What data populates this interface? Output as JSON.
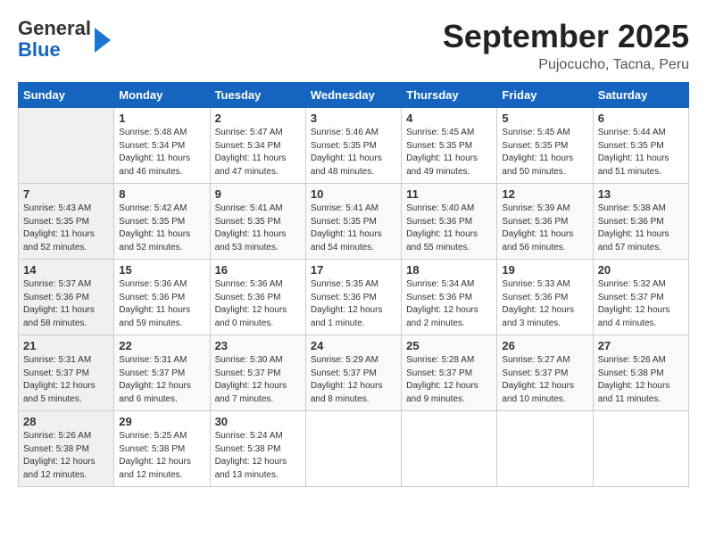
{
  "header": {
    "logo_line1": "General",
    "logo_line2": "Blue",
    "month": "September 2025",
    "location": "Pujocucho, Tacna, Peru"
  },
  "weekdays": [
    "Sunday",
    "Monday",
    "Tuesday",
    "Wednesday",
    "Thursday",
    "Friday",
    "Saturday"
  ],
  "weeks": [
    [
      {
        "day": "",
        "info": ""
      },
      {
        "day": "1",
        "info": "Sunrise: 5:48 AM\nSunset: 5:34 PM\nDaylight: 11 hours\nand 46 minutes."
      },
      {
        "day": "2",
        "info": "Sunrise: 5:47 AM\nSunset: 5:34 PM\nDaylight: 11 hours\nand 47 minutes."
      },
      {
        "day": "3",
        "info": "Sunrise: 5:46 AM\nSunset: 5:35 PM\nDaylight: 11 hours\nand 48 minutes."
      },
      {
        "day": "4",
        "info": "Sunrise: 5:45 AM\nSunset: 5:35 PM\nDaylight: 11 hours\nand 49 minutes."
      },
      {
        "day": "5",
        "info": "Sunrise: 5:45 AM\nSunset: 5:35 PM\nDaylight: 11 hours\nand 50 minutes."
      },
      {
        "day": "6",
        "info": "Sunrise: 5:44 AM\nSunset: 5:35 PM\nDaylight: 11 hours\nand 51 minutes."
      }
    ],
    [
      {
        "day": "7",
        "info": "Sunrise: 5:43 AM\nSunset: 5:35 PM\nDaylight: 11 hours\nand 52 minutes."
      },
      {
        "day": "8",
        "info": "Sunrise: 5:42 AM\nSunset: 5:35 PM\nDaylight: 11 hours\nand 52 minutes."
      },
      {
        "day": "9",
        "info": "Sunrise: 5:41 AM\nSunset: 5:35 PM\nDaylight: 11 hours\nand 53 minutes."
      },
      {
        "day": "10",
        "info": "Sunrise: 5:41 AM\nSunset: 5:35 PM\nDaylight: 11 hours\nand 54 minutes."
      },
      {
        "day": "11",
        "info": "Sunrise: 5:40 AM\nSunset: 5:36 PM\nDaylight: 11 hours\nand 55 minutes."
      },
      {
        "day": "12",
        "info": "Sunrise: 5:39 AM\nSunset: 5:36 PM\nDaylight: 11 hours\nand 56 minutes."
      },
      {
        "day": "13",
        "info": "Sunrise: 5:38 AM\nSunset: 5:36 PM\nDaylight: 11 hours\nand 57 minutes."
      }
    ],
    [
      {
        "day": "14",
        "info": "Sunrise: 5:37 AM\nSunset: 5:36 PM\nDaylight: 11 hours\nand 58 minutes."
      },
      {
        "day": "15",
        "info": "Sunrise: 5:36 AM\nSunset: 5:36 PM\nDaylight: 11 hours\nand 59 minutes."
      },
      {
        "day": "16",
        "info": "Sunrise: 5:36 AM\nSunset: 5:36 PM\nDaylight: 12 hours\nand 0 minutes."
      },
      {
        "day": "17",
        "info": "Sunrise: 5:35 AM\nSunset: 5:36 PM\nDaylight: 12 hours\nand 1 minute."
      },
      {
        "day": "18",
        "info": "Sunrise: 5:34 AM\nSunset: 5:36 PM\nDaylight: 12 hours\nand 2 minutes."
      },
      {
        "day": "19",
        "info": "Sunrise: 5:33 AM\nSunset: 5:36 PM\nDaylight: 12 hours\nand 3 minutes."
      },
      {
        "day": "20",
        "info": "Sunrise: 5:32 AM\nSunset: 5:37 PM\nDaylight: 12 hours\nand 4 minutes."
      }
    ],
    [
      {
        "day": "21",
        "info": "Sunrise: 5:31 AM\nSunset: 5:37 PM\nDaylight: 12 hours\nand 5 minutes."
      },
      {
        "day": "22",
        "info": "Sunrise: 5:31 AM\nSunset: 5:37 PM\nDaylight: 12 hours\nand 6 minutes."
      },
      {
        "day": "23",
        "info": "Sunrise: 5:30 AM\nSunset: 5:37 PM\nDaylight: 12 hours\nand 7 minutes."
      },
      {
        "day": "24",
        "info": "Sunrise: 5:29 AM\nSunset: 5:37 PM\nDaylight: 12 hours\nand 8 minutes."
      },
      {
        "day": "25",
        "info": "Sunrise: 5:28 AM\nSunset: 5:37 PM\nDaylight: 12 hours\nand 9 minutes."
      },
      {
        "day": "26",
        "info": "Sunrise: 5:27 AM\nSunset: 5:37 PM\nDaylight: 12 hours\nand 10 minutes."
      },
      {
        "day": "27",
        "info": "Sunrise: 5:26 AM\nSunset: 5:38 PM\nDaylight: 12 hours\nand 11 minutes."
      }
    ],
    [
      {
        "day": "28",
        "info": "Sunrise: 5:26 AM\nSunset: 5:38 PM\nDaylight: 12 hours\nand 12 minutes."
      },
      {
        "day": "29",
        "info": "Sunrise: 5:25 AM\nSunset: 5:38 PM\nDaylight: 12 hours\nand 12 minutes."
      },
      {
        "day": "30",
        "info": "Sunrise: 5:24 AM\nSunset: 5:38 PM\nDaylight: 12 hours\nand 13 minutes."
      },
      {
        "day": "",
        "info": ""
      },
      {
        "day": "",
        "info": ""
      },
      {
        "day": "",
        "info": ""
      },
      {
        "day": "",
        "info": ""
      }
    ]
  ]
}
